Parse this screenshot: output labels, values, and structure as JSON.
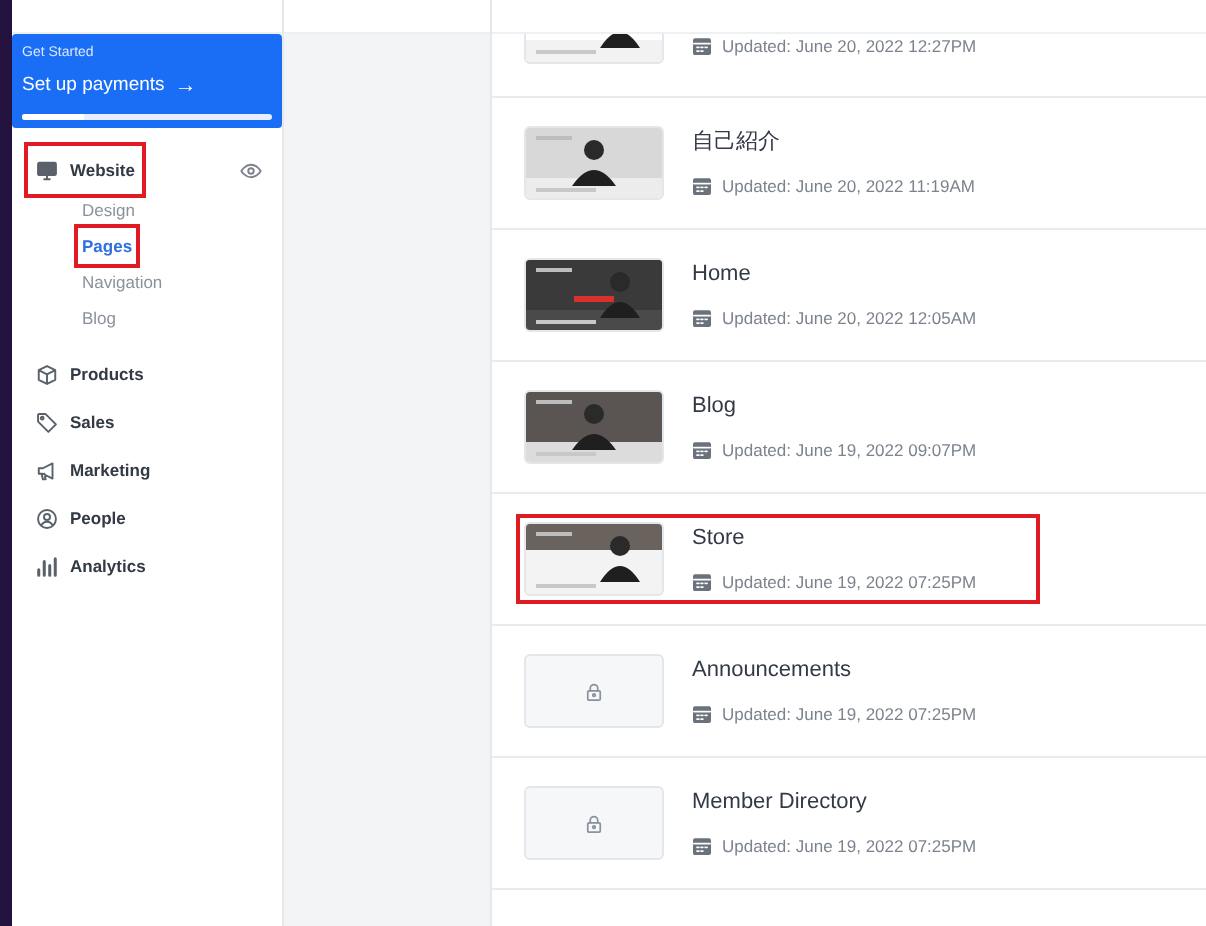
{
  "get_started": {
    "label": "Get Started",
    "action": "Set up payments",
    "arrow": "→",
    "level": 0.25
  },
  "sidebar": {
    "items": [
      {
        "label": "Website",
        "highlighted": true,
        "children": [
          {
            "label": "Design",
            "selected": false,
            "highlighted": false
          },
          {
            "label": "Pages",
            "selected": true,
            "highlighted": true
          },
          {
            "label": "Navigation",
            "selected": false,
            "highlighted": false
          },
          {
            "label": "Blog",
            "selected": false,
            "highlighted": false
          }
        ]
      },
      {
        "label": "Products",
        "highlighted": false
      },
      {
        "label": "Sales",
        "highlighted": false
      },
      {
        "label": "Marketing",
        "highlighted": false
      },
      {
        "label": "People",
        "highlighted": false
      },
      {
        "label": "Analytics",
        "highlighted": false
      }
    ]
  },
  "pages": [
    {
      "kind": "picture",
      "updated": "Updated: June 20, 2022 12:27PM",
      "highlighted": false
    },
    {
      "kind": "picture",
      "title": "自己紹介",
      "updated": "Updated: June 20, 2022 11:19AM",
      "highlighted": false
    },
    {
      "kind": "picture",
      "title": "Home",
      "updated": "Updated: June 20, 2022 12:05AM",
      "highlighted": false
    },
    {
      "kind": "picture",
      "title": "Blog",
      "updated": "Updated: June 19, 2022 09:07PM",
      "highlighted": false
    },
    {
      "kind": "picture",
      "title": "Store",
      "updated": "Updated: June 19, 2022 07:25PM",
      "highlighted": true
    },
    {
      "kind": "locked",
      "title": "Announcements",
      "updated": "Updated: June 19, 2022 07:25PM",
      "highlighted": false
    },
    {
      "kind": "locked",
      "title": "Member Directory",
      "updated": "Updated: June 19, 2022 07:25PM",
      "highlighted": false
    }
  ]
}
